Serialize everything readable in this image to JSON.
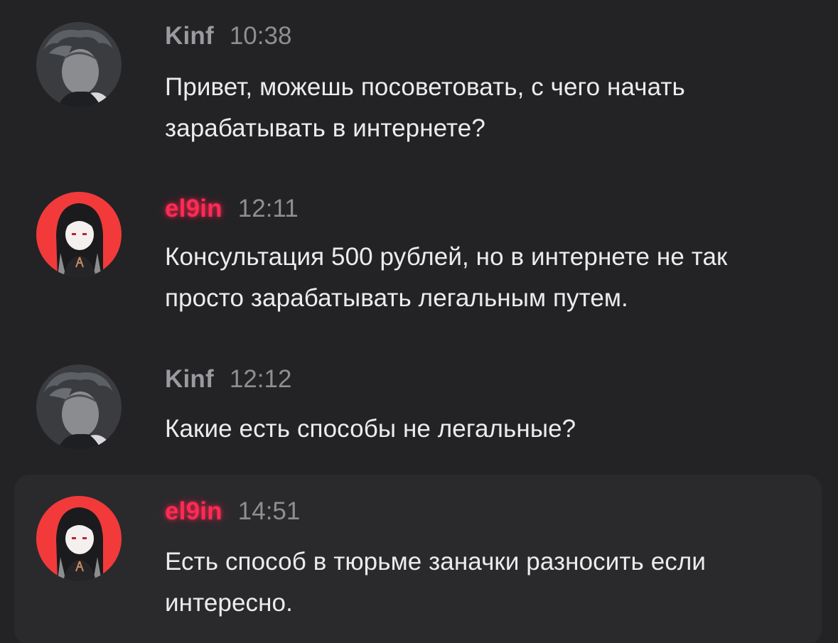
{
  "messages": [
    {
      "author": "Kinf",
      "time": "10:38",
      "text": "Привет, можешь посоветовать, с чего начать зарабатывать в интернете?"
    },
    {
      "author": "el9in",
      "time": "12:11",
      "text": "Консультация 500 рублей, но в интернете не так просто зарабатывать легальным путем."
    },
    {
      "author": "Kinf",
      "time": "12:12",
      "text": "Какие есть способы не легальные?"
    },
    {
      "author": "el9in",
      "time": "14:51",
      "text": "Есть способ в тюрьме заначки разносить если интересно."
    }
  ],
  "colors": {
    "background": "#232325",
    "highlight_background": "#2a2a2d",
    "kinf_name": "#9a9a9f",
    "el9in_name": "#ff2a55",
    "el9in_avatar_bg": "#f23a3a",
    "timestamp": "#8e8e93",
    "message_text": "#ececee"
  },
  "icons": {
    "kinf_avatar": "user-avatar-photo",
    "el9in_avatar": "user-avatar-anime-girl"
  }
}
